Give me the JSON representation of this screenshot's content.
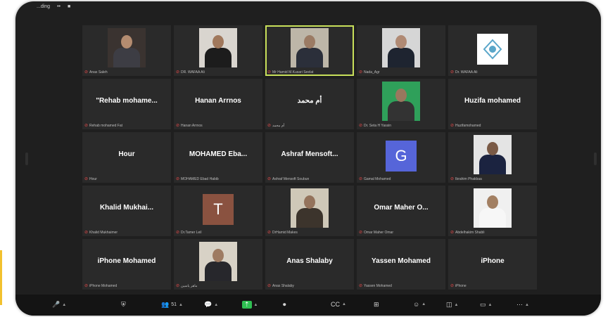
{
  "window": {
    "top_status": [
      "...ding",
      "••",
      "■"
    ]
  },
  "tiles": [
    {
      "id": "anas-saleh",
      "kind": "video",
      "label": "Anas Saleh",
      "colors": {
        "bg": "#3a3330",
        "head": "#b48c70",
        "body": "#3d3d44"
      }
    },
    {
      "id": "dr-wafa",
      "kind": "video",
      "label": "DR. WAFAA Ali",
      "colors": {
        "bg": "#d9d5cf",
        "head": "#a0785c",
        "body": "#1c1c1c"
      }
    },
    {
      "id": "dr-hamid",
      "kind": "video",
      "active": true,
      "label": "Mr Hamid M.Kusari Seelat",
      "colors": {
        "bg": "#bdb6a8",
        "head": "#9b7b64",
        "body": "#2b2f3a"
      }
    },
    {
      "id": "nada",
      "kind": "video",
      "label": "Nada_Agr",
      "colors": {
        "bg": "#d6d6d6",
        "head": "#b08a74",
        "body": "#1e2430"
      }
    },
    {
      "id": "dr-wafaa-logo",
      "kind": "logo",
      "label": "Dr. WAFAA Ali",
      "colors": {
        "bg": "#ffffff",
        "logo": "#5aa6c9"
      }
    },
    {
      "id": "rehab",
      "kind": "name",
      "name": "\"Rehab mohame...",
      "label": "Rehab mohamed Fat"
    },
    {
      "id": "hanan",
      "kind": "name",
      "name": "Hanan Arrnos",
      "label": "Hanan Arrnos"
    },
    {
      "id": "om-mohammad",
      "kind": "name",
      "name": "أم محمد",
      "label": "أم محمد"
    },
    {
      "id": "dr-seta",
      "kind": "video",
      "label": "Dr. Seta H Yassin",
      "colors": {
        "bg": "#2fa05a",
        "head": "#9a775e",
        "body": "#333333"
      }
    },
    {
      "id": "huzifa",
      "kind": "name",
      "name": "Huzifa mohamed",
      "label": "Huzifamohamed"
    },
    {
      "id": "hour",
      "kind": "name",
      "name": "Hour",
      "label": "Hour"
    },
    {
      "id": "mohamed-eba",
      "kind": "name",
      "name": "MOHAMED Eba...",
      "label": "MOHAMED Ebad Habib"
    },
    {
      "id": "ashraf",
      "kind": "name",
      "name": "Ashraf Mensoft...",
      "label": "Ashraf Mensoft Soubun"
    },
    {
      "id": "g-ahmad",
      "kind": "letter",
      "letter": "G",
      "label": "Gamal Mohamed",
      "colors": {
        "bg": "#5665d9"
      }
    },
    {
      "id": "ibrahim",
      "kind": "video",
      "label": "Ibrahim Phakbaa",
      "colors": {
        "bg": "#e4e4e4",
        "head": "#7a5a46",
        "body": "#1b2340"
      }
    },
    {
      "id": "khalid",
      "kind": "name",
      "name": "Khalid Mukhai...",
      "label": "Khalid Mukhaimer"
    },
    {
      "id": "t-tamer",
      "kind": "letter",
      "letter": "T",
      "label": "Dr.Tamer Leil",
      "colors": {
        "bg": "#8a5240"
      }
    },
    {
      "id": "dr-hamid2",
      "kind": "video",
      "label": "DrHamid Makes",
      "colors": {
        "bg": "#cfc8b8",
        "head": "#94735c",
        "body": "#3c342c"
      }
    },
    {
      "id": "omar",
      "kind": "name",
      "name": "Omar Maher O...",
      "label": "Omar Maher Omar"
    },
    {
      "id": "abdelhakim",
      "kind": "video",
      "label": "Abdelhakim Shabli",
      "colors": {
        "bg": "#f0f0f0",
        "head": "#a27f62",
        "body": "#f7f7f7"
      }
    },
    {
      "id": "iphone-mohamed",
      "kind": "name",
      "name": "iPhone Mohamed",
      "label": "iPhone Mohamed"
    },
    {
      "id": "maher",
      "kind": "video",
      "label": "ماهر ياسين",
      "colors": {
        "bg": "#d8d2c6",
        "head": "#9e7b62",
        "body": "#27272c"
      }
    },
    {
      "id": "anas-shalaby",
      "kind": "name",
      "name": "Anas Shalaby",
      "label": "Anas Shalaby"
    },
    {
      "id": "yassen",
      "kind": "name",
      "name": "Yassen Mohamed",
      "label": "Yassen Mohamed"
    },
    {
      "id": "iphone",
      "kind": "name",
      "name": "iPhone",
      "label": "iPhone"
    }
  ],
  "toolbar": [
    {
      "id": "mute",
      "icon": "mic-icon",
      "glyph": "🎤",
      "caret": true
    },
    {
      "id": "security",
      "icon": "shield-icon",
      "glyph": "⛨",
      "caret": false
    },
    {
      "id": "participants",
      "icon": "participants-icon",
      "glyph": "👥",
      "count": "51",
      "caret": true
    },
    {
      "id": "chat",
      "icon": "chat-icon",
      "glyph": "💬",
      "caret": true
    },
    {
      "id": "share",
      "icon": "share-screen-icon",
      "glyph": "⇡",
      "caret": true
    },
    {
      "id": "record",
      "icon": "record-icon",
      "glyph": "⏺",
      "caret": false
    },
    {
      "id": "captions",
      "icon": "captions-icon",
      "glyph": "CC",
      "caret": true
    },
    {
      "id": "breakout",
      "icon": "breakout-icon",
      "glyph": "⊞",
      "caret": false
    },
    {
      "id": "reactions",
      "icon": "reactions-icon",
      "glyph": "☺",
      "caret": true
    },
    {
      "id": "apps",
      "icon": "apps-icon",
      "glyph": "◫",
      "caret": true
    },
    {
      "id": "whiteboard",
      "icon": "whiteboard-icon",
      "glyph": "▭",
      "caret": true
    },
    {
      "id": "more",
      "icon": "more-icon",
      "glyph": "⋯",
      "caret": true
    }
  ],
  "colors": {
    "active_speaker": "#c8e05a",
    "share_button": "#2fbf52",
    "mic_off": "#e04848"
  }
}
